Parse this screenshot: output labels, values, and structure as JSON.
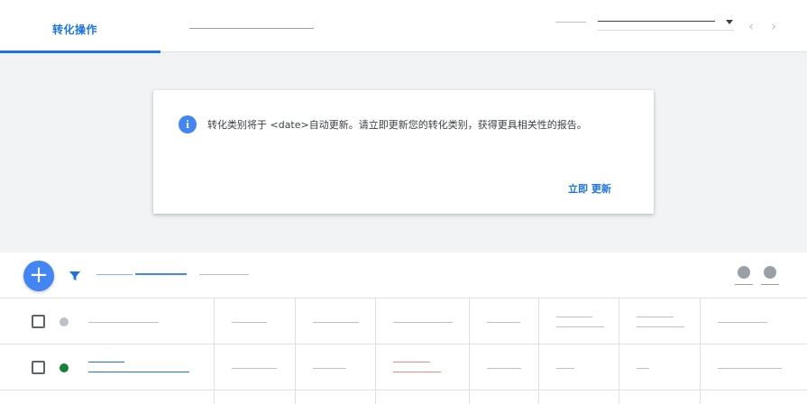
{
  "tabs": {
    "active_label": "转化操作"
  },
  "date_range": {
    "selected": ""
  },
  "notice": {
    "message": "转化类别将于 <date>自动更新。请立即更新您的转化类别，获得更具相关性的报告。",
    "action_label": "立即 更新"
  },
  "icons": {
    "info": "info-icon",
    "add": "add-icon",
    "filter": "filter-icon",
    "prev": "chevron-left-icon",
    "next": "chevron-right-icon"
  },
  "glyphs": {
    "info": "i",
    "add": "+",
    "prev": "‹",
    "next": "›"
  },
  "colors": {
    "accent": "#1a73e8",
    "status_inactive": "#bdc1c6",
    "status_active": "#188038",
    "warning_text": "#ea4335"
  }
}
